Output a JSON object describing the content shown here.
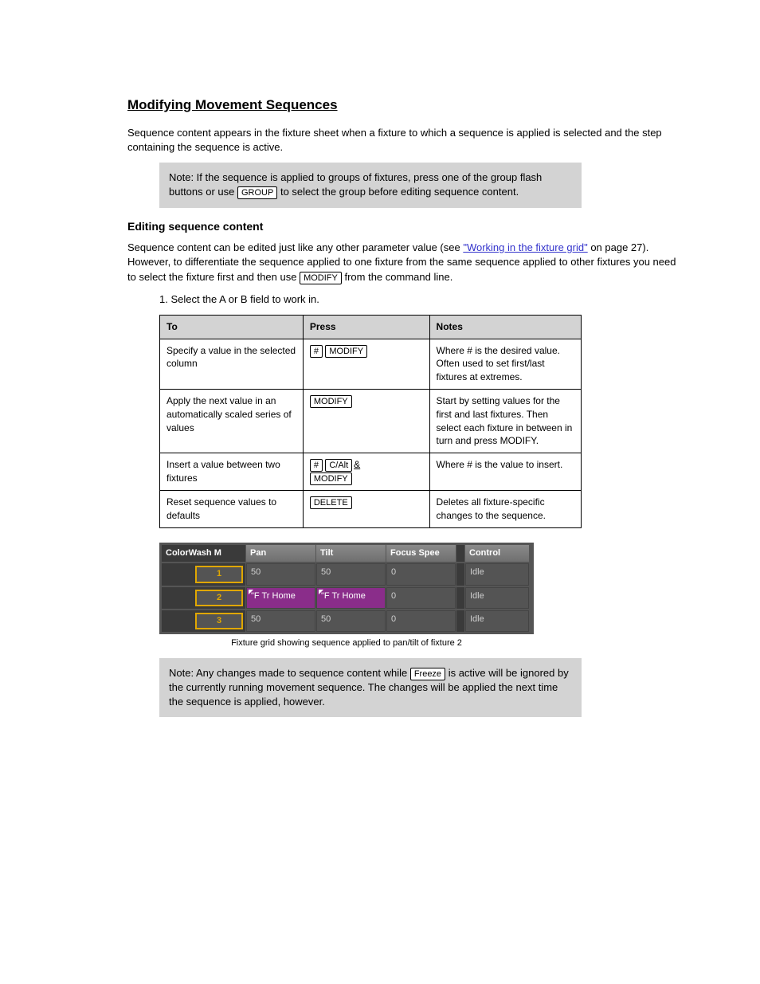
{
  "section": {
    "title": "Modifying Movement Sequences",
    "intro": "Sequence content appears in the fixture sheet when a fixture to which a sequence is applied is selected and the step containing the sequence is active.",
    "note1_prefix": "Note: If the sequence is applied to groups of fixtures, press one of the group flash buttons or use ",
    "note1_key": "GROUP",
    "note1_suffix": " to select the group before editing sequence content.",
    "editing_heading": "Editing sequence content",
    "para2_prefix": "Sequence content can be edited just like any other parameter value (see ",
    "para2_link": "\"Working in the fixture grid\"",
    "para2_link_page": " on page 27",
    "para2_suffix": "). However, to differentiate the sequence applied to one fixture from the same sequence applied to other fixtures you need to select the fixture first and then use ",
    "para2_key": "MODIFY",
    "para2_suffix2": " from the command line.",
    "table_caption": "1. Select the A or B field to work in.",
    "table_header": {
      "to": "To",
      "press": "Press",
      "notes": "Notes"
    },
    "rows": [
      {
        "to": "Specify a value in the selected column",
        "press_main": [
          "#",
          "MODIFY"
        ],
        "press_extra": "",
        "notes": "Where # is the desired value. Often used to set first/last fixtures at extremes."
      },
      {
        "to": "Apply the next value in an automatically scaled series of values",
        "press_main": [
          "MODIFY"
        ],
        "press_extra": "",
        "notes": "Start by setting values for the first and last fixtures. Then select each fixture in between in turn and press MODIFY."
      },
      {
        "to": "Insert a value between two fixtures",
        "press_main": [
          "#",
          "C/Alt",
          "&",
          "MODIFY"
        ],
        "press_extra": "",
        "notes": "Where # is the value to insert."
      },
      {
        "to": "Reset sequence values to defaults",
        "press_main": [
          "DELETE"
        ],
        "press_extra": "",
        "notes": "Deletes all fixture-specific changes to the sequence."
      }
    ]
  },
  "fixture_grid": {
    "headers": [
      "ColorWash M",
      "Pan",
      "Tilt",
      "Focus Spee",
      "Control"
    ],
    "rows": [
      {
        "id": "1",
        "pan": "50",
        "tilt": "50",
        "focus": "0",
        "control": "Idle",
        "purple": false
      },
      {
        "id": "2",
        "pan": "\"F Tr Home",
        "tilt": "\"F Tr Home",
        "focus": "0",
        "control": "Idle",
        "purple": true
      },
      {
        "id": "3",
        "pan": "50",
        "tilt": "50",
        "focus": "0",
        "control": "Idle",
        "purple": false
      }
    ],
    "caption": "Fixture grid showing sequence applied to pan/tilt of fixture 2"
  },
  "note2": {
    "prefix": "Note: Any changes made to sequence content while ",
    "key": "Freeze",
    "suffix": " is active will be ignored by the currently running movement sequence. The changes will be applied the next time the sequence is applied, however."
  }
}
